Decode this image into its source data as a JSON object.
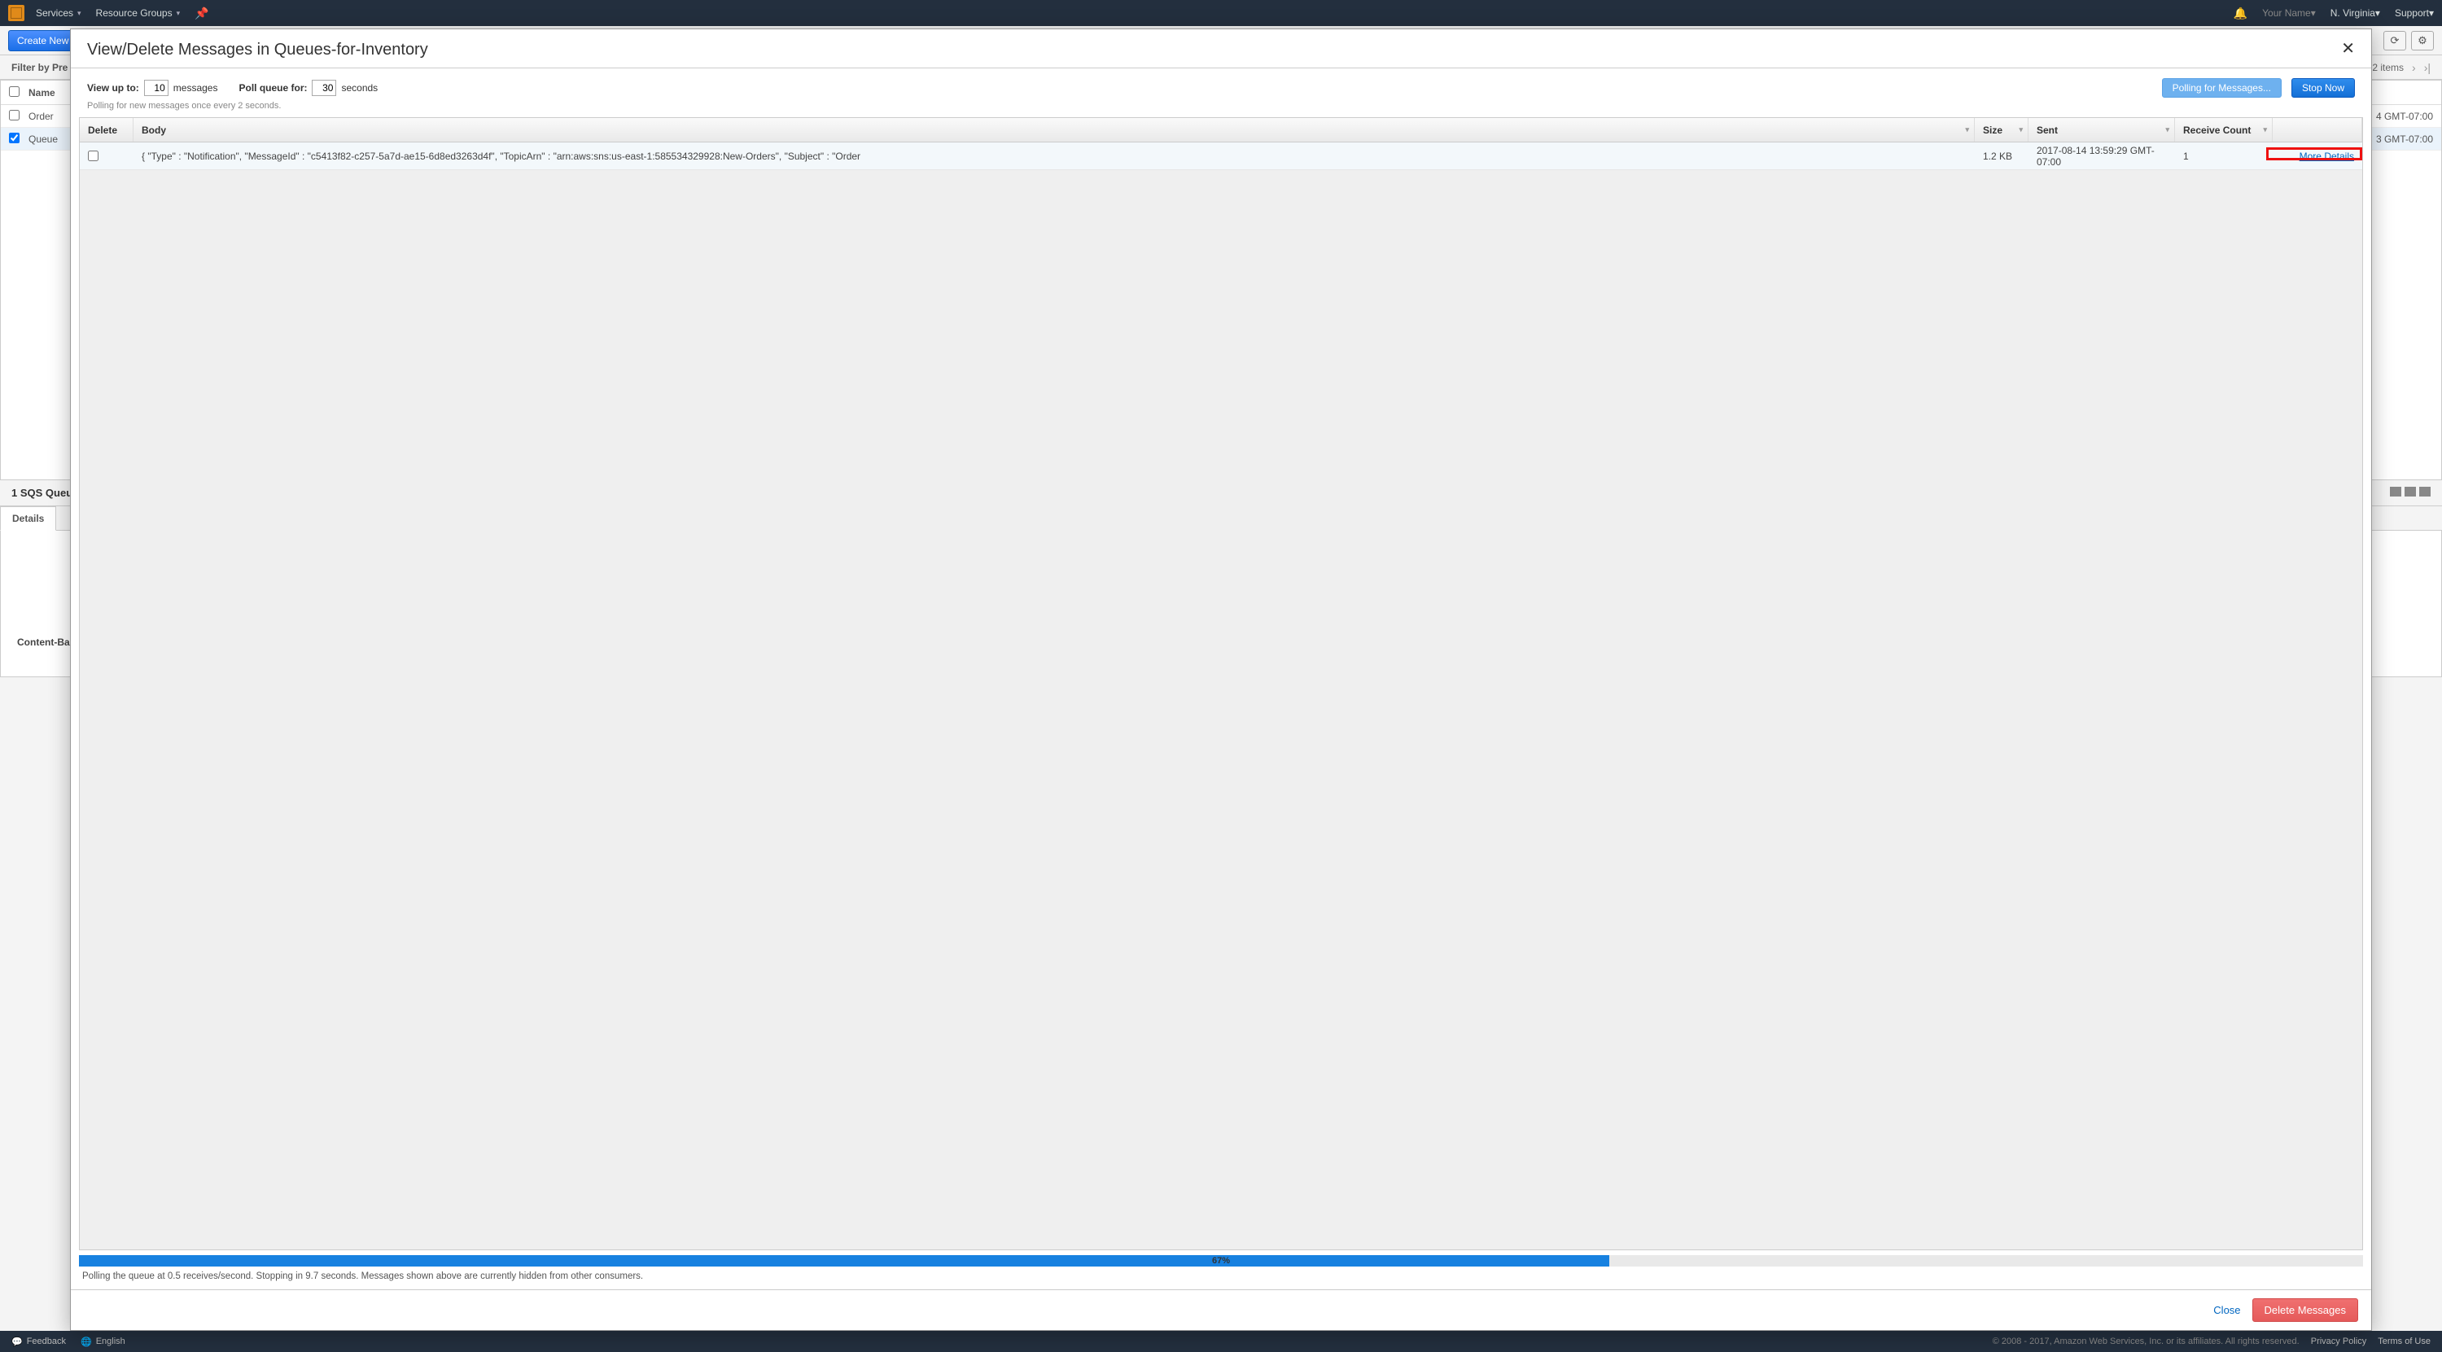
{
  "topnav": {
    "services": "Services",
    "resource_groups": "Resource Groups",
    "user": "Your Name",
    "region": "N. Virginia",
    "support": "Support"
  },
  "toolbar": {
    "create": "Create New"
  },
  "filterbar": {
    "label": "Filter by Pre",
    "items_count": "2 items"
  },
  "queues_table": {
    "header_name": "Name",
    "rows": [
      {
        "name": "Order",
        "checked": false,
        "ts": "4 GMT-07:00"
      },
      {
        "name": "Queue",
        "checked": true,
        "ts": "3 GMT-07:00"
      }
    ]
  },
  "split": {
    "selected_label": "1 SQS Queue"
  },
  "tabs": {
    "details": "Details"
  },
  "details": {
    "content_based": "Content-Ba"
  },
  "modal": {
    "title": "View/Delete Messages in Queues-for-Inventory",
    "view_up_to_label": "View up to:",
    "view_up_to_value": "10",
    "messages_label": "messages",
    "poll_for_label": "Poll queue for:",
    "poll_for_value": "30",
    "seconds_label": "seconds",
    "polling_button": "Polling for Messages...",
    "stop_button": "Stop Now",
    "subtext": "Polling for new messages once every 2 seconds.",
    "columns": {
      "delete": "Delete",
      "body": "Body",
      "size": "Size",
      "sent": "Sent",
      "receive_count": "Receive Count"
    },
    "rows": [
      {
        "body": "{ \"Type\" : \"Notification\", \"MessageId\" : \"c5413f82-c257-5a7d-ae15-6d8ed3263d4f\", \"TopicArn\" : \"arn:aws:sns:us-east-1:585534329928:New-Orders\", \"Subject\" : \"Order",
        "size": "1.2 KB",
        "sent": "2017-08-14 13:59:29 GMT-07:00",
        "receive_count": "1",
        "more": "More Details"
      }
    ],
    "progress_pct": "67%",
    "progress_width": 67,
    "polling_status": "Polling the queue at 0.5 receives/second. Stopping in 9.7 seconds. Messages shown above are currently hidden from other consumers.",
    "close": "Close",
    "delete_messages": "Delete Messages"
  },
  "footer": {
    "feedback": "Feedback",
    "language": "English",
    "copyright": "© 2008 - 2017, Amazon Web Services, Inc. or its affiliates. All rights reserved.",
    "privacy": "Privacy Policy",
    "terms": "Terms of Use"
  }
}
